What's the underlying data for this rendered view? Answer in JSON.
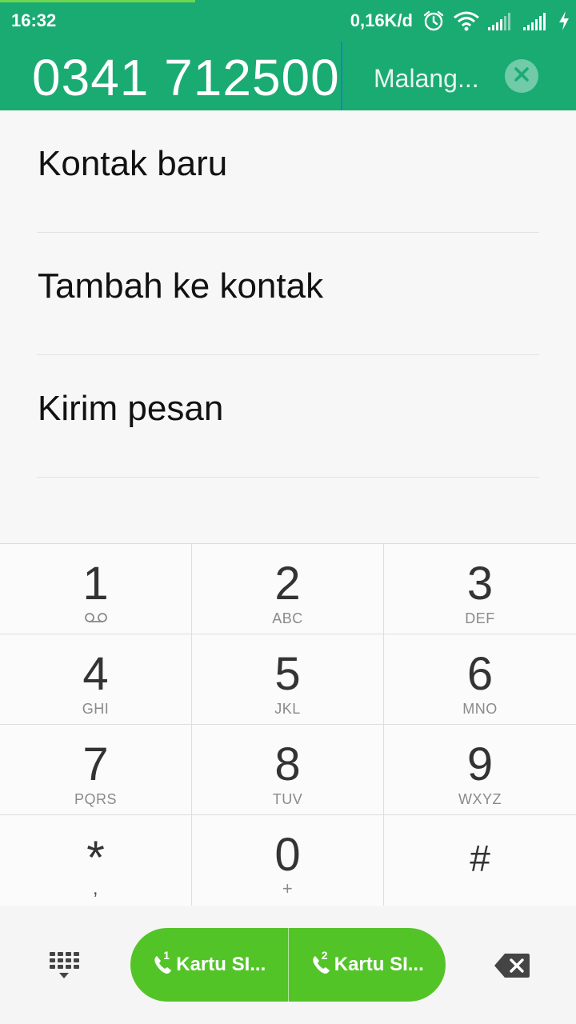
{
  "status_bar": {
    "time": "16:32",
    "net_speed": "0,16K/d",
    "icons": [
      "alarm-icon",
      "wifi-icon",
      "signal-sim1-icon",
      "signal-sim2-icon",
      "charging-icon"
    ]
  },
  "dialer": {
    "number": "0341 712500",
    "location": "Malang...",
    "clear_icon": "close-circle-icon"
  },
  "menu": {
    "items": [
      {
        "label": "Kontak baru"
      },
      {
        "label": "Tambah ke kontak"
      },
      {
        "label": "Kirim pesan"
      }
    ]
  },
  "keypad": {
    "keys": [
      {
        "digit": "1",
        "sub": "",
        "icon": "voicemail-icon"
      },
      {
        "digit": "2",
        "sub": "ABC"
      },
      {
        "digit": "3",
        "sub": "DEF"
      },
      {
        "digit": "4",
        "sub": "GHI"
      },
      {
        "digit": "5",
        "sub": "JKL"
      },
      {
        "digit": "6",
        "sub": "MNO"
      },
      {
        "digit": "7",
        "sub": "PQRS"
      },
      {
        "digit": "8",
        "sub": "TUV"
      },
      {
        "digit": "9",
        "sub": "WXYZ"
      },
      {
        "digit": "*",
        "sub": ","
      },
      {
        "digit": "0",
        "sub": "+"
      },
      {
        "digit": "#",
        "sub": ""
      }
    ]
  },
  "bottom_bar": {
    "sim1_label": "Kartu SI...",
    "sim1_num": "1",
    "sim2_label": "Kartu SI...",
    "sim2_num": "2",
    "call_color": "#53c428"
  },
  "colors": {
    "header": "#1aab73",
    "accent": "#53c428"
  }
}
